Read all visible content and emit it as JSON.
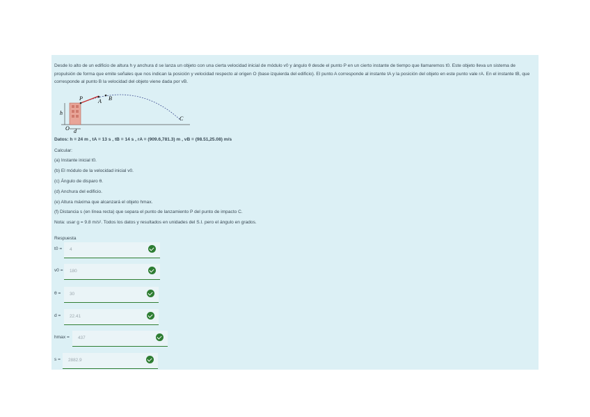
{
  "problem": {
    "intro": "Desde lo alto de un edificio de altura h y anchura d se lanza un objeto con una cierta velocidad inicial de módulo v0 y ángulo θ desde el punto P en un cierto instante de tiempo que llamaremos t0. Este objeto lleva un sistema de propulsión de forma que emite señales que nos indican la posición y velocidad respecto al origen O (base izquierda del edificio). El punto A corresponde al instante tA y la posición del objeto en este punto vale rA. En el instante tB, que corresponde al punto B la velocidad del objeto viene dada por vB.",
    "figure_labels": {
      "p": "P",
      "a": "A",
      "b": "B",
      "c": "C",
      "h": "h",
      "o": "O",
      "d": "d"
    },
    "data_line": "Datos: h = 24 m , tA = 13 s , tB = 14 s , rA = (909.6,781.3) m , vB = (98.51,25.08) m/s",
    "calculate_label": "Calcular:",
    "items": [
      "(a) Instante inicial t0.",
      "(b) El módulo de la velocidad inicial v0.",
      "(c) Ángulo de disparo θ.",
      "(d) Anchura del edificio.",
      "(e) Altura máxima que alcanzará el objeto hmax.",
      "(f) Distancia s (en línea recta) que separa el punto de lanzamiento P del punto de impacto C."
    ],
    "note": "Nota: usar g = 9.8 m/s². Todos los datos y resultados en unidades del S.I. pero el ángulo en grados."
  },
  "answers_label": "Respuesta",
  "answers": [
    {
      "label": "t0 =",
      "value": "4"
    },
    {
      "label": "v0 =",
      "value": "180"
    },
    {
      "label": "θ =",
      "value": "30"
    },
    {
      "label": "d =",
      "value": "22.41"
    },
    {
      "label": "hmax =",
      "value": "437"
    },
    {
      "label": "s =",
      "value": "2882.9"
    }
  ],
  "colors": {
    "panel": "#dcf0f5",
    "success": "#2e7d32",
    "field": "#eaf4f7"
  }
}
